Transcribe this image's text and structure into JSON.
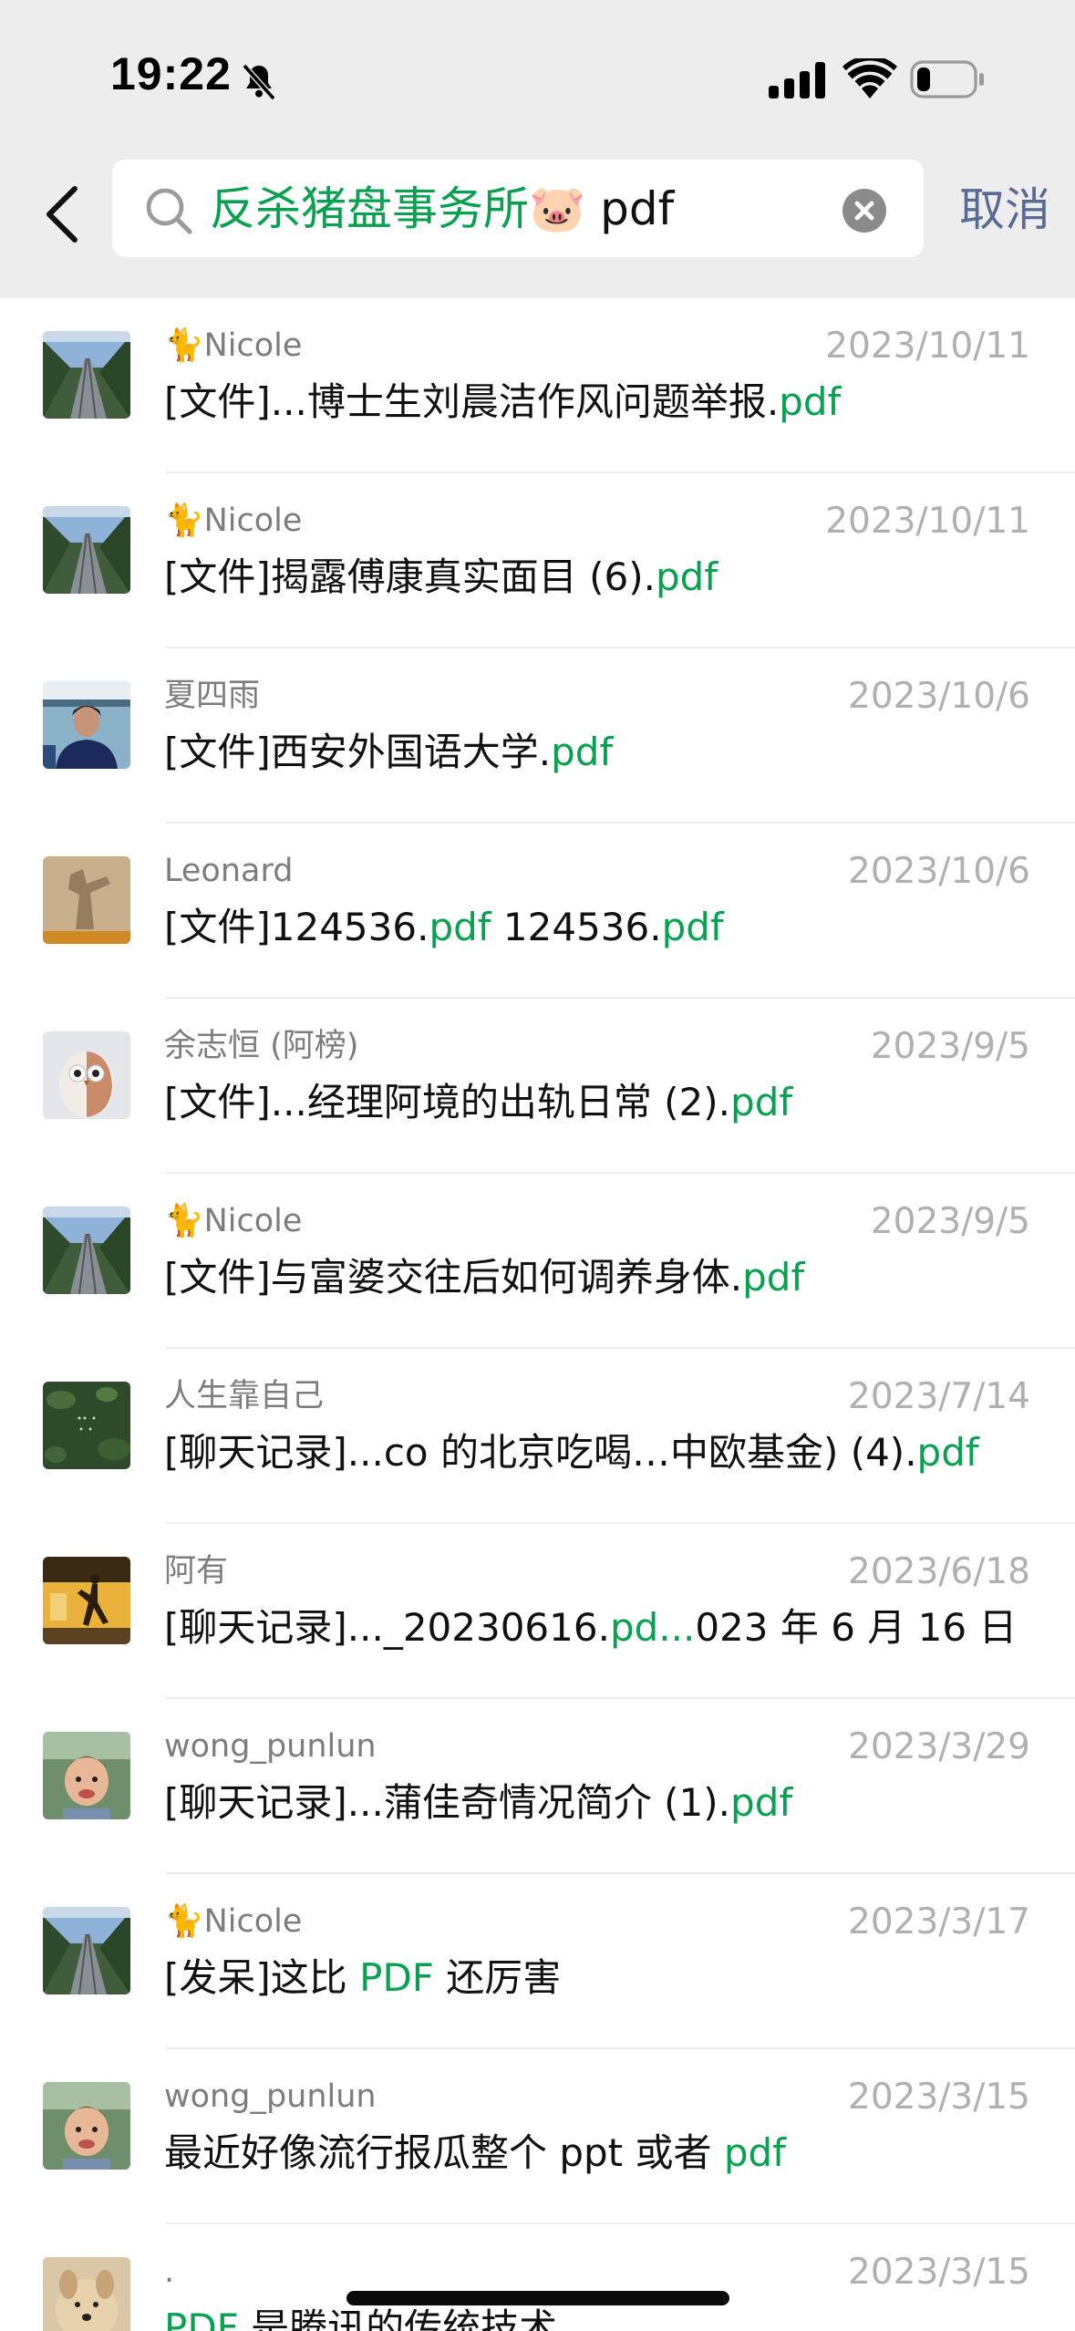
{
  "status_bar": {
    "time": "19:22"
  },
  "search": {
    "query_highlight": "反杀猪盘事务所🐷",
    "query_rest": " pdf",
    "cancel_label": "取消"
  },
  "colors": {
    "highlight": "#07a14f",
    "link_blue": "#576b95",
    "header_bg": "#ededed"
  },
  "results": [
    {
      "name": "🐈Nicole",
      "date": "2023/10/11",
      "avatar": "railway",
      "parts": [
        "[文件]...博士生刘晨洁作风问题举报.",
        "pdf"
      ]
    },
    {
      "name": "🐈Nicole",
      "date": "2023/10/11",
      "avatar": "railway",
      "parts": [
        "[文件]揭露傅康真实面目 (6).",
        "pdf"
      ]
    },
    {
      "name": "夏四雨",
      "date": "2023/10/6",
      "avatar": "person-portrait",
      "parts": [
        "[文件]西安外国语大学.",
        "pdf"
      ]
    },
    {
      "name": "Leonard",
      "date": "2023/10/6",
      "avatar": "shadow-wall",
      "parts": [
        "[文件]124536.",
        "pdf",
        " 124536.",
        "pdf"
      ]
    },
    {
      "name": "余志恒 (阿榜)",
      "date": "2023/9/5",
      "avatar": "owl",
      "parts": [
        "[文件]...经理阿境的出轨日常 (2).",
        "pdf"
      ]
    },
    {
      "name": "🐈Nicole",
      "date": "2023/9/5",
      "avatar": "railway",
      "parts": [
        "[文件]与富婆交往后如何调养身体.",
        "pdf"
      ]
    },
    {
      "name": "人生靠自己",
      "date": "2023/7/14",
      "avatar": "green-leaves",
      "parts": [
        "[聊天记录]...co 的北京吃喝…中欧基金) (4).",
        "pdf"
      ]
    },
    {
      "name": "阿有",
      "date": "2023/6/18",
      "avatar": "dancer",
      "parts": [
        "[聊天记录]..._20230616.",
        "pd...",
        "023 年 6 月 16 日"
      ]
    },
    {
      "name": "wong_punlun",
      "date": "2023/3/29",
      "avatar": "child",
      "parts": [
        "[聊天记录]...蒲佳奇情况简介 (1).",
        "pdf"
      ]
    },
    {
      "name": "🐈Nicole",
      "date": "2023/3/17",
      "avatar": "railway",
      "parts": [
        "[发呆]这比 ",
        "PDF",
        " 还厉害"
      ]
    },
    {
      "name": "wong_punlun",
      "date": "2023/3/15",
      "avatar": "child",
      "parts": [
        "最近好像流行报瓜整个 ppt 或者 ",
        "pdf"
      ]
    },
    {
      "name": ".",
      "date": "2023/3/15",
      "avatar": "dog",
      "parts": [
        "",
        "PDF",
        " 是腾讯的传统技术"
      ]
    }
  ]
}
